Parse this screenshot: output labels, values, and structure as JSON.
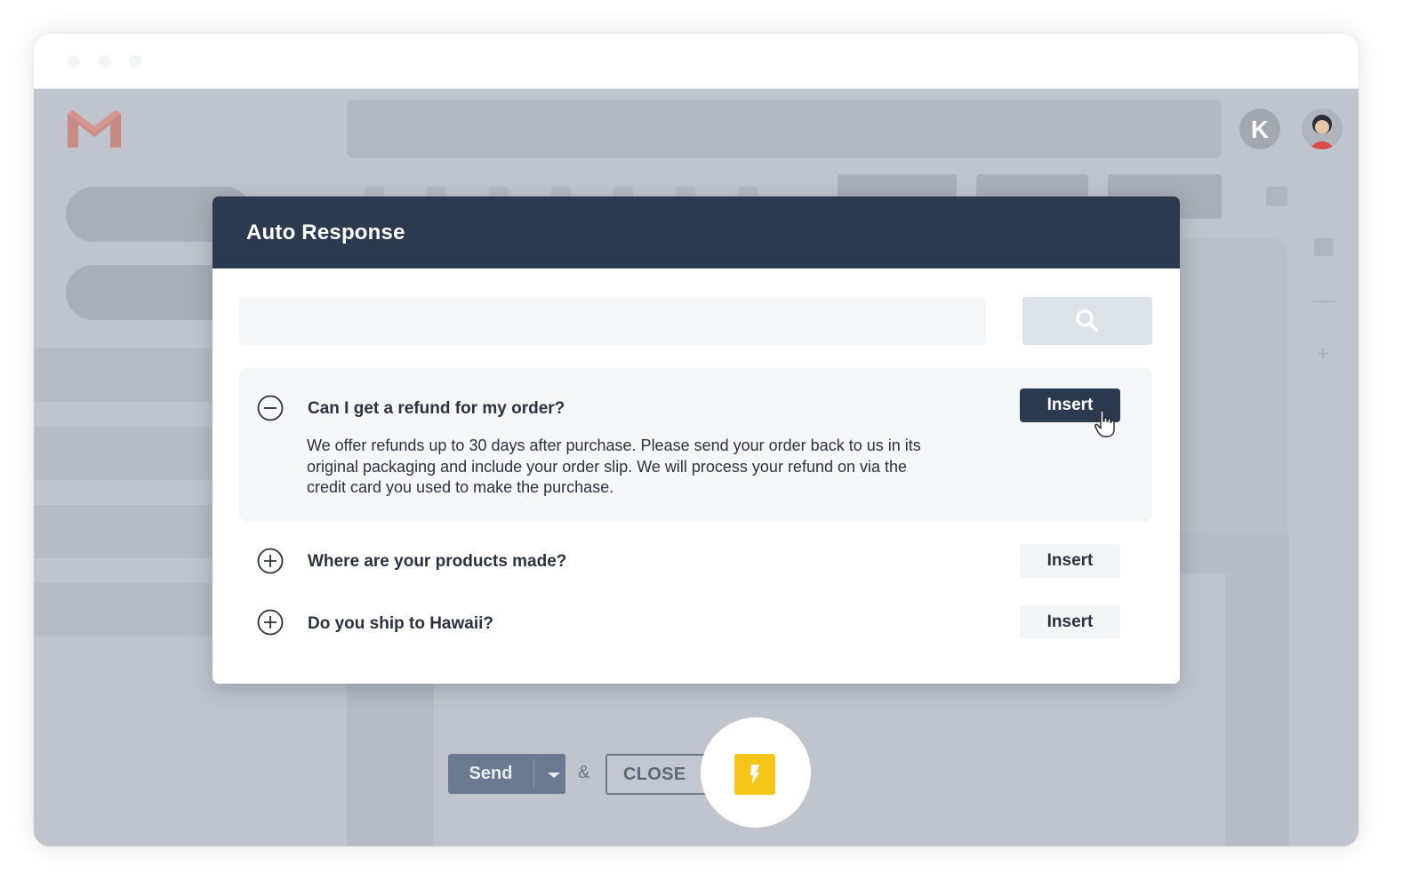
{
  "modal": {
    "title": "Auto Response",
    "search": {
      "placeholder": "",
      "value": ""
    },
    "search_icon": "search-icon",
    "items": [
      {
        "question": "Can I get a refund for my order?",
        "expanded": true,
        "answer": "We offer refunds up to 30 days after purchase.  Please send your order back to us in its original packaging and include your order slip.  We will process your refund on via the credit card you used to make the purchase.",
        "insert_label": "Insert"
      },
      {
        "question": "Where are your products made?",
        "expanded": false,
        "insert_label": "Insert"
      },
      {
        "question": "Do you ship to Hawaii?",
        "expanded": false,
        "insert_label": "Insert"
      }
    ]
  },
  "compose": {
    "send_label": "Send",
    "ampersand": "&",
    "close_label": "CLOSE",
    "bolt_icon": "lightning-icon"
  },
  "colors": {
    "header": "#2c3a4f",
    "send_button": "#6b7a90",
    "bolt_button": "#f5c518",
    "backdrop": "#bfc4cd"
  }
}
